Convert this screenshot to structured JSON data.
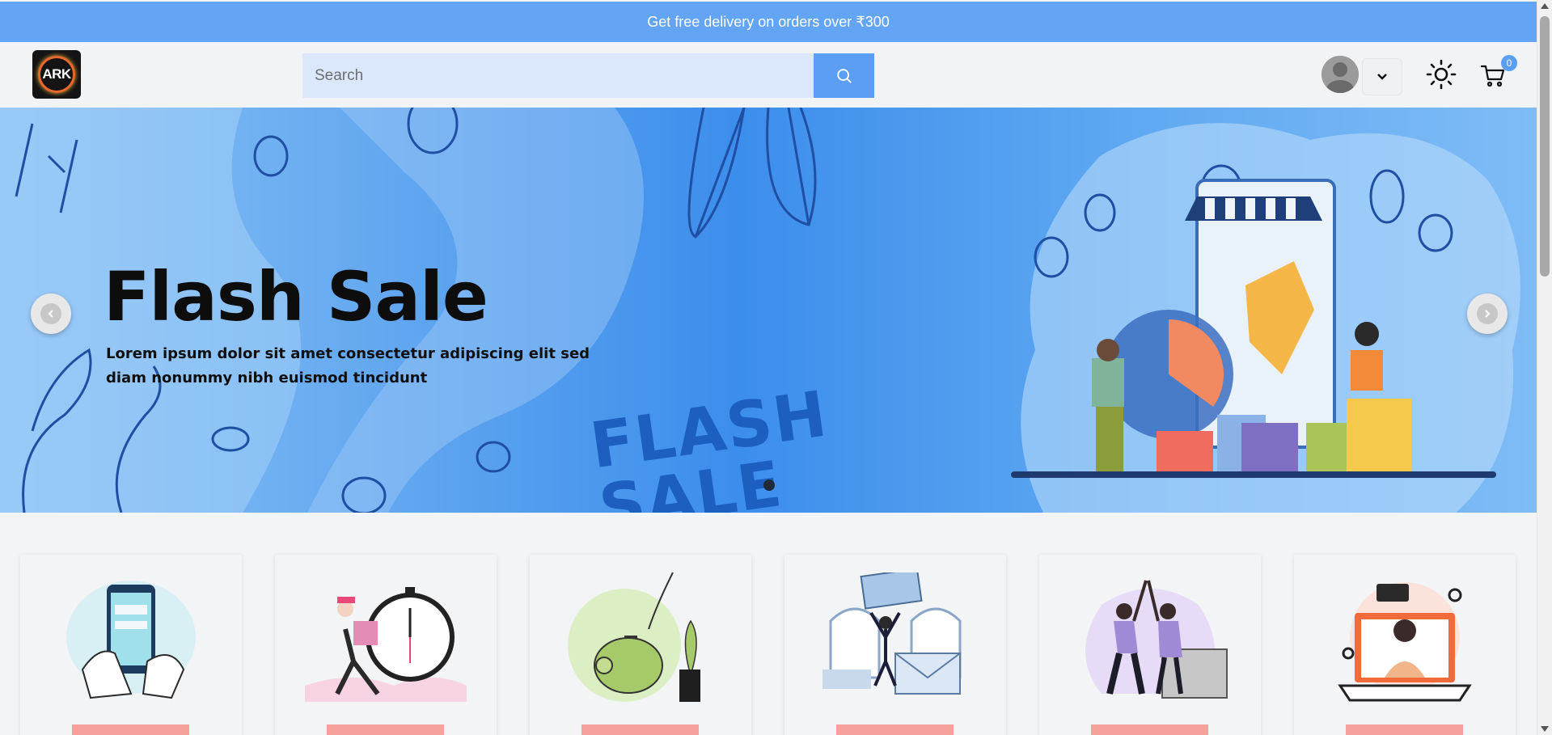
{
  "promo": {
    "text": "Get free delivery on orders over ₹300"
  },
  "header": {
    "logo_text": "ARK",
    "search_placeholder": "Search",
    "search_icon": "search-icon",
    "avatar_icon": "user-avatar",
    "dropdown_icon": "chevron-down-icon",
    "theme_icon": "sun-icon",
    "cart_icon": "cart-icon",
    "cart_count": "0"
  },
  "hero": {
    "title": "Flash Sale",
    "subtitle": "Lorem ipsum dolor sit amet consectetur adipiscing elit sed diam nonummy nibh euismod tincidunt",
    "stamp_line1": "FLASH",
    "stamp_line2": "SALE",
    "slide_count": 1,
    "active_slide": 1
  },
  "cards": [
    {
      "illustration": "mobile-payment-illustration"
    },
    {
      "illustration": "fast-delivery-stopwatch-illustration"
    },
    {
      "illustration": "piggy-bank-savings-illustration"
    },
    {
      "illustration": "gift-card-celebration-illustration"
    },
    {
      "illustration": "high-five-teamwork-illustration"
    },
    {
      "illustration": "online-support-laptop-illustration"
    }
  ],
  "colors": {
    "promo_bg": "#63a4f5",
    "accent": "#5b9ef3",
    "search_bg": "#dbe8fb",
    "card_button": "#f6a09c"
  }
}
